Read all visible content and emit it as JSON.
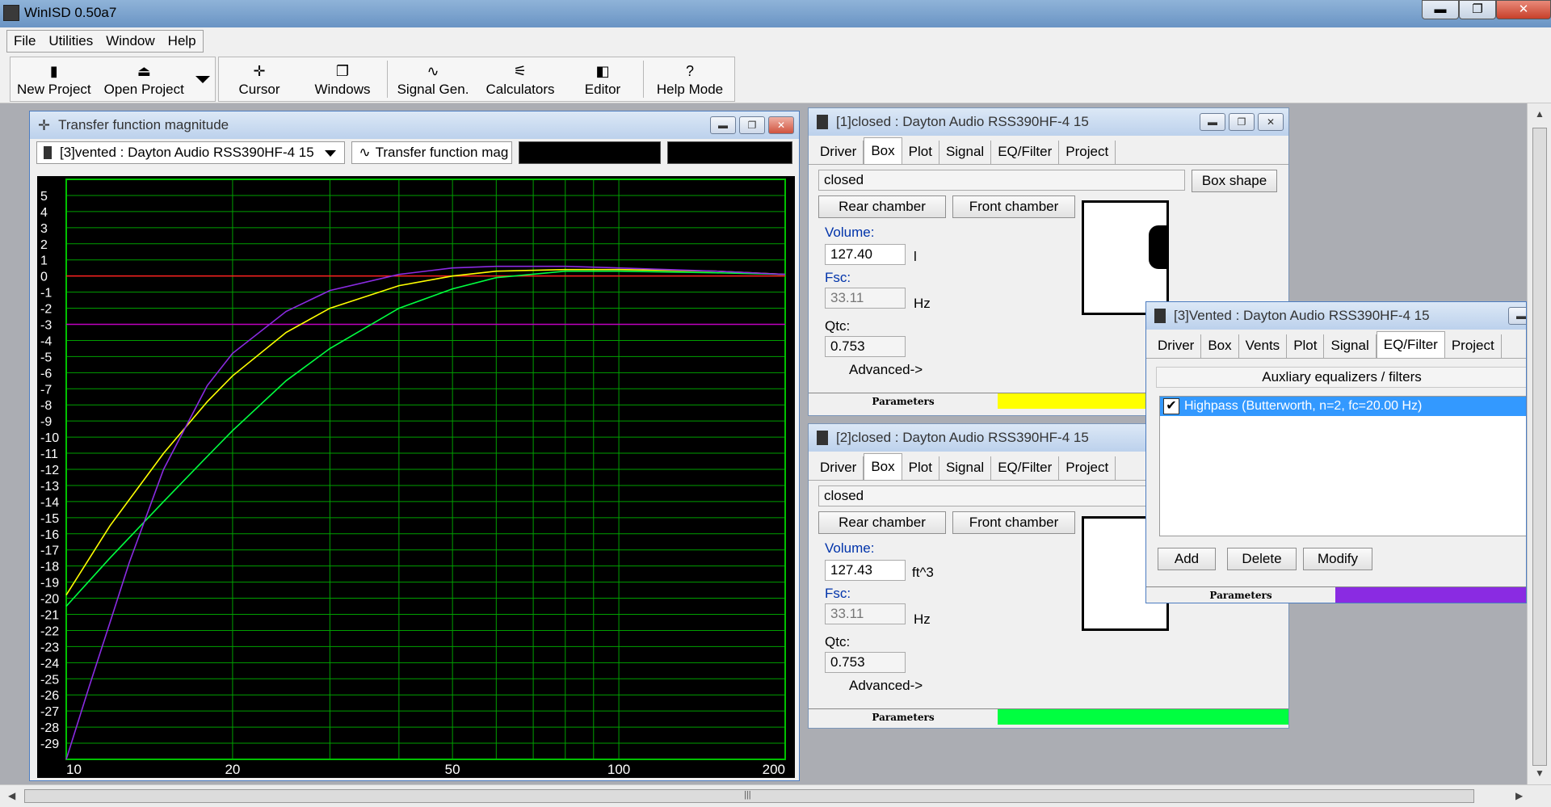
{
  "app": {
    "title": "WinISD 0.50a7"
  },
  "window_controls": {
    "minimize": "▬",
    "restore": "❐",
    "close": "✕"
  },
  "menu": [
    "File",
    "Utilities",
    "Window",
    "Help"
  ],
  "toolbar": [
    {
      "label": "New Project",
      "icon": "new-project-icon",
      "glyph": "▮"
    },
    {
      "label": "Open Project",
      "icon": "open-project-icon",
      "glyph": "⏏"
    },
    {
      "label": "Cursor",
      "icon": "cursor-icon",
      "glyph": "✛"
    },
    {
      "label": "Windows",
      "icon": "windows-icon",
      "glyph": "❐"
    },
    {
      "label": "Signal Gen.",
      "icon": "signal-gen-icon",
      "glyph": "∿"
    },
    {
      "label": "Calculators",
      "icon": "calculators-icon",
      "glyph": "⚟"
    },
    {
      "label": "Editor",
      "icon": "editor-icon",
      "glyph": "◧"
    },
    {
      "label": "Help Mode",
      "icon": "help-icon",
      "glyph": "?"
    }
  ],
  "graph": {
    "title": "Transfer function magnitude",
    "project_combo": "[3]vented : Dayton Audio RSS390HF-4 15",
    "graph_type_combo": "Transfer function mag"
  },
  "chart_data": {
    "type": "line",
    "title": "",
    "xlabel": "",
    "ylabel": "",
    "xscale": "log",
    "xlim": [
      10,
      200
    ],
    "ylim": [
      -30,
      6
    ],
    "x_ticks": [
      10,
      20,
      50,
      100,
      200
    ],
    "y_ticks": [
      5,
      4,
      3,
      2,
      1,
      0,
      -1,
      -2,
      -3,
      -4,
      -5,
      -6,
      -7,
      -8,
      -9,
      -10,
      -11,
      -12,
      -13,
      -14,
      -15,
      -16,
      -17,
      -18,
      -19,
      -20,
      -21,
      -22,
      -23,
      -24,
      -25,
      -26,
      -27,
      -28,
      -29
    ],
    "grid": true,
    "reference_lines": [
      {
        "y": 0,
        "color": "#ff2020"
      },
      {
        "y": -3,
        "color": "#c000c0"
      }
    ],
    "series": [
      {
        "color": "#ffff00",
        "x": [
          10,
          12,
          15,
          18,
          20,
          25,
          30,
          40,
          50,
          60,
          80,
          100,
          150,
          200
        ],
        "y": [
          -19.8,
          -15.5,
          -11.0,
          -7.8,
          -6.2,
          -3.5,
          -2.0,
          -0.6,
          0.0,
          0.3,
          0.4,
          0.4,
          0.3,
          0.1
        ]
      },
      {
        "color": "#00ff40",
        "x": [
          10,
          12,
          15,
          18,
          20,
          25,
          30,
          40,
          50,
          60,
          80,
          100,
          150,
          200
        ],
        "y": [
          -20.5,
          -17.5,
          -14.0,
          -11.2,
          -9.6,
          -6.5,
          -4.5,
          -2.0,
          -0.8,
          -0.1,
          0.3,
          0.3,
          0.2,
          0.1
        ]
      },
      {
        "color": "#8a2be2",
        "x": [
          10,
          11,
          12,
          13,
          15,
          18,
          20,
          25,
          30,
          40,
          50,
          60,
          80,
          100,
          150,
          200
        ],
        "y": [
          -30.0,
          -25.5,
          -21.5,
          -17.8,
          -12.0,
          -6.8,
          -4.8,
          -2.2,
          -0.9,
          0.1,
          0.5,
          0.6,
          0.6,
          0.5,
          0.3,
          0.1
        ]
      }
    ]
  },
  "proj1": {
    "title": "[1]closed :  Dayton Audio RSS390HF-4 15",
    "tabs": [
      "Driver",
      "Box",
      "Plot",
      "Signal",
      "EQ/Filter",
      "Project"
    ],
    "box_type": "closed",
    "box_shape_btn": "Box shape",
    "rear_tab": "Rear chamber",
    "front_tab": "Front chamber",
    "volume_label": "Volume:",
    "volume": "127.40",
    "volume_unit": "l",
    "fsc_label": "Fsc:",
    "fsc": "33.11",
    "fsc_unit": "Hz",
    "qtc_label": "Qtc:",
    "qtc": "0.753",
    "advanced": "Advanced->",
    "params": "Parameters",
    "color": "#ffff00"
  },
  "proj2": {
    "title": "[2]closed :  Dayton Audio RSS390HF-4 15",
    "tabs": [
      "Driver",
      "Box",
      "Plot",
      "Signal",
      "EQ/Filter",
      "Project"
    ],
    "box_type": "closed",
    "rear_tab": "Rear chamber",
    "front_tab": "Front chamber",
    "volume_label": "Volume:",
    "volume": "127.43",
    "volume_unit": "ft^3",
    "fsc_label": "Fsc:",
    "fsc": "33.11",
    "fsc_unit": "Hz",
    "qtc_label": "Qtc:",
    "qtc": "0.753",
    "advanced": "Advanced->",
    "params": "Parameters",
    "color": "#00ff40"
  },
  "proj3": {
    "title": "[3]Vented : Dayton Audio RSS390HF-4 15",
    "tabs": [
      "Driver",
      "Box",
      "Vents",
      "Plot",
      "Signal",
      "EQ/Filter",
      "Project"
    ],
    "section": "Auxliary equalizers / filters",
    "filter": "Highpass (Butterworth, n=2, fc=20.00 Hz)",
    "add": "Add",
    "delete": "Delete",
    "modify": "Modify",
    "params": "Parameters",
    "color": "#8a2be2"
  },
  "scroll": {
    "up": "▲",
    "down": "▼",
    "left": "◀",
    "right": "▶",
    "grip": "|||"
  }
}
